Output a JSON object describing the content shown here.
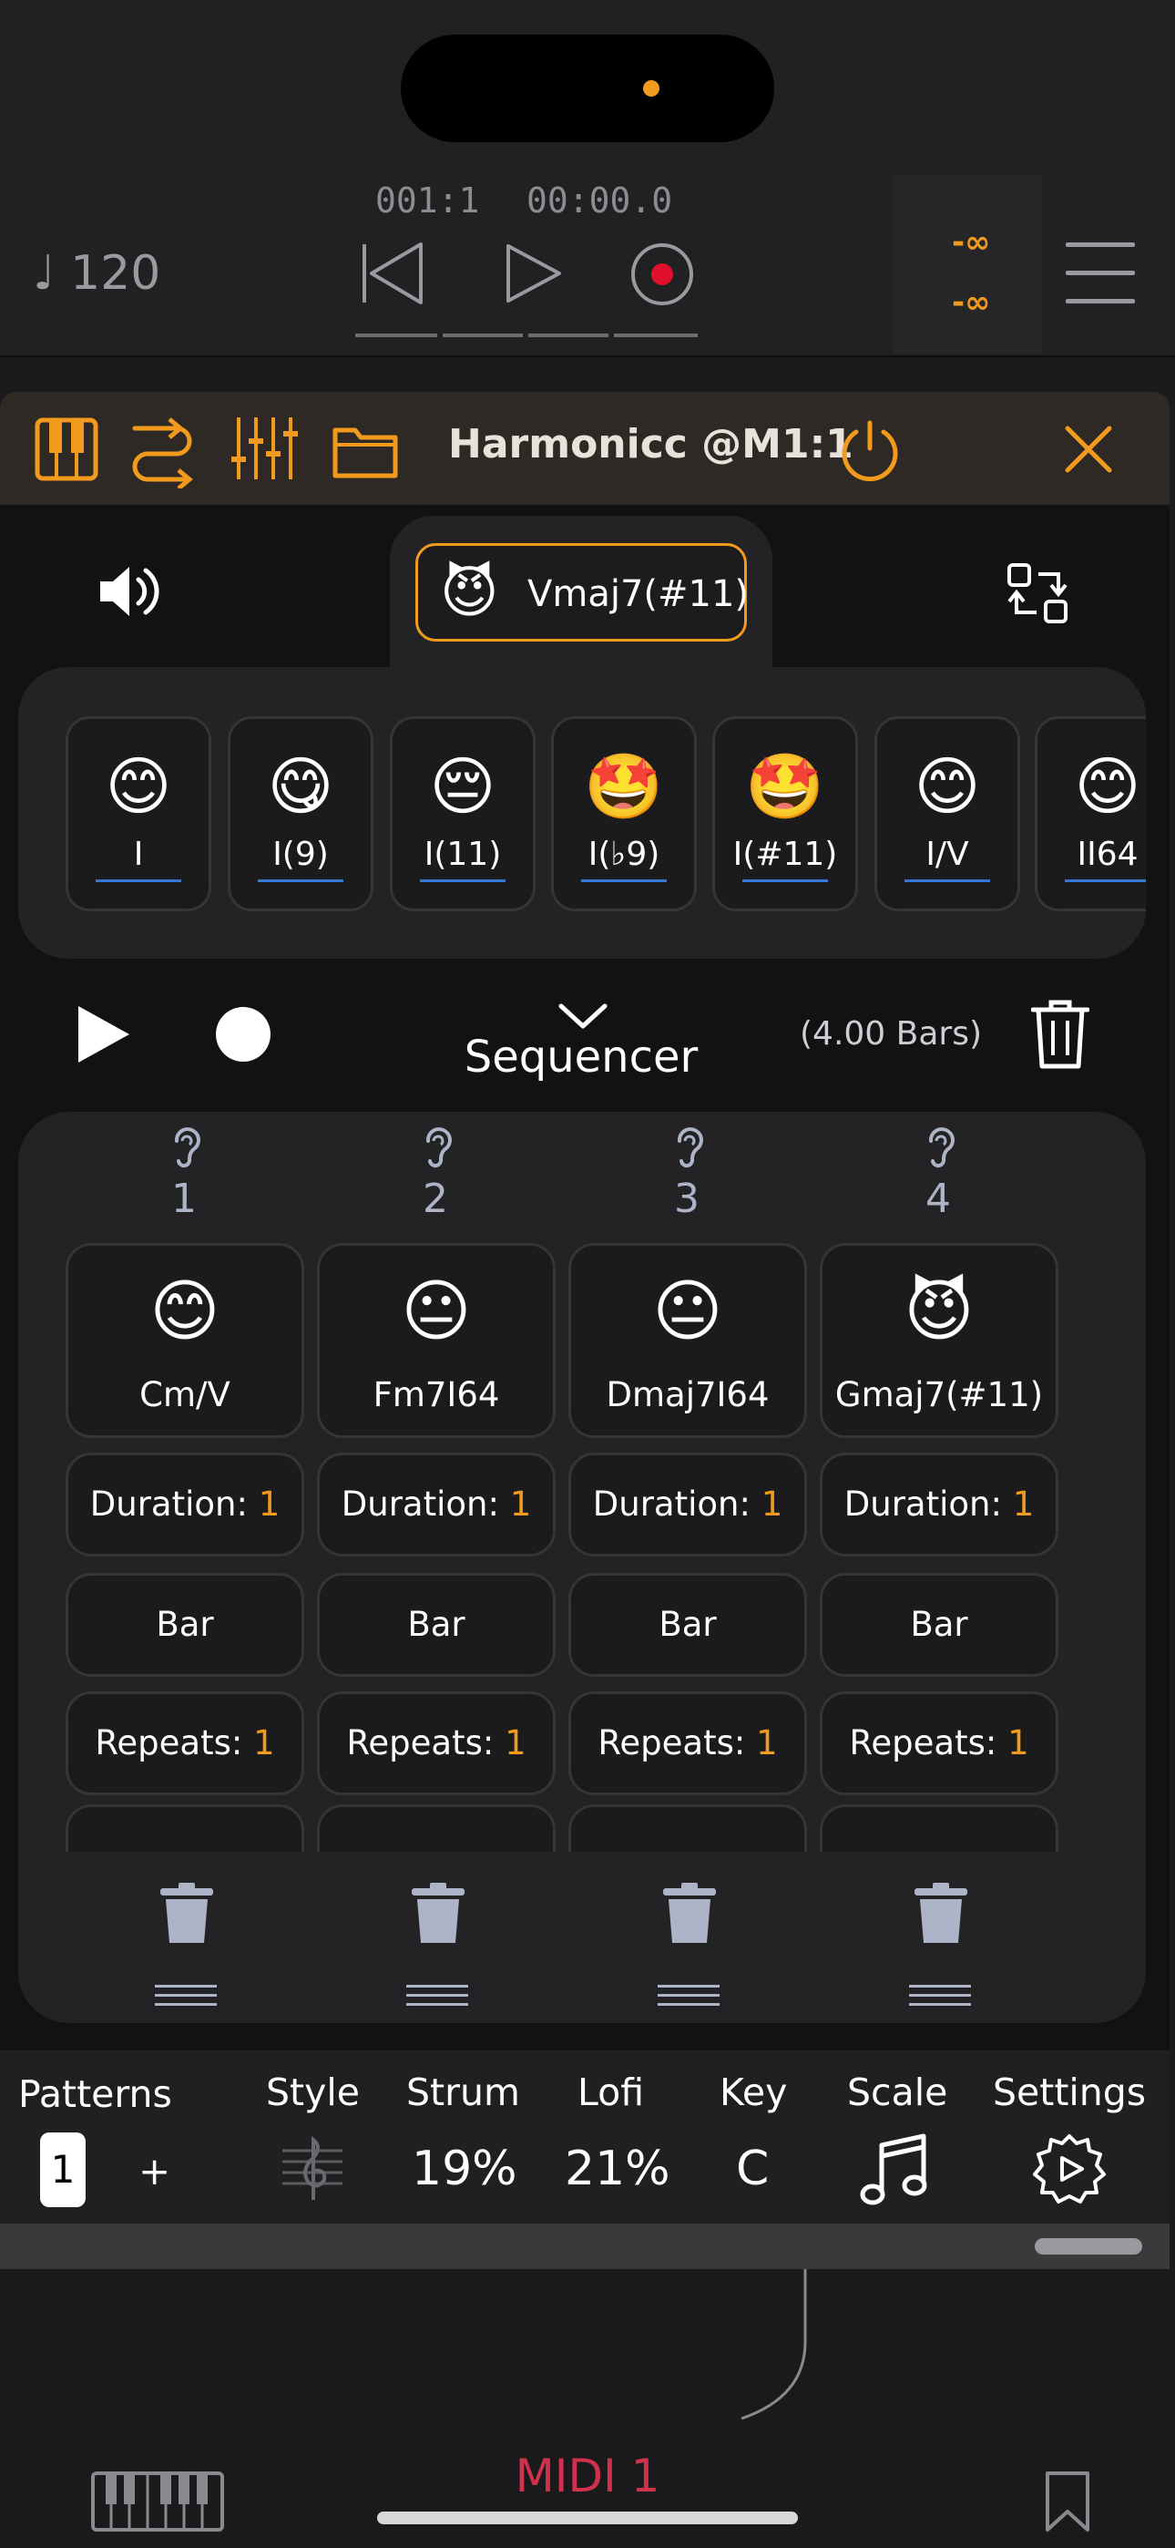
{
  "host": {
    "tempo": "120",
    "position_bars": "001:1",
    "position_time": "00:00.0",
    "meter_top": "-∞",
    "meter_bottom": "-∞",
    "track_label": "MIDI 1"
  },
  "plugin": {
    "title": "Harmonicc @M1:1",
    "current_chord": {
      "emoji": "😈",
      "label": "Vmaj7(#11)"
    },
    "palette": [
      {
        "emoji": "😊",
        "label": "I"
      },
      {
        "emoji": "😋",
        "label": "I(9)"
      },
      {
        "emoji": "😔",
        "label": "I(11)"
      },
      {
        "emoji": "🤩",
        "label": "I(♭9)"
      },
      {
        "emoji": "🤩",
        "label": "I(#11)"
      },
      {
        "emoji": "😊",
        "label": "I/V"
      },
      {
        "emoji": "😊",
        "label": "II64"
      }
    ]
  },
  "sequencer": {
    "label": "Sequencer",
    "length": "(4.00 Bars)",
    "steps": [
      {
        "number": "1",
        "emoji": "😊",
        "chord": "Cm/V",
        "duration_label": "Duration:",
        "duration": "1",
        "mode": "Bar",
        "repeats_label": "Repeats:",
        "repeats": "1"
      },
      {
        "number": "2",
        "emoji": "😐",
        "chord": "Fm7I64",
        "duration_label": "Duration:",
        "duration": "1",
        "mode": "Bar",
        "repeats_label": "Repeats:",
        "repeats": "1"
      },
      {
        "number": "3",
        "emoji": "😐",
        "chord": "Dmaj7I64",
        "duration_label": "Duration:",
        "duration": "1",
        "mode": "Bar",
        "repeats_label": "Repeats:",
        "repeats": "1"
      },
      {
        "number": "4",
        "emoji": "😈",
        "chord": "Gmaj7(#11)",
        "duration_label": "Duration:",
        "duration": "1",
        "mode": "Bar",
        "repeats_label": "Repeats:",
        "repeats": "1"
      }
    ]
  },
  "controls": {
    "patterns_label": "Patterns",
    "pattern_selected": "1",
    "pattern_add": "+",
    "style_label": "Style",
    "strum_label": "Strum",
    "strum_value": "19%",
    "lofi_label": "Lofi",
    "lofi_value": "21%",
    "key_label": "Key",
    "key_value": "C",
    "scale_label": "Scale",
    "settings_label": "Settings"
  },
  "colors": {
    "accent": "#f29a1e",
    "underline": "#3777d6",
    "track": "#d0314c"
  },
  "icons": {
    "header": [
      "piano-keys-icon",
      "route-icon",
      "mixer-sliders-icon",
      "folder-icon",
      "power-icon",
      "close-icon"
    ],
    "transport": [
      "skip-back-icon",
      "play-icon",
      "record-icon",
      "menu-icon"
    ],
    "plugin": [
      "speaker-icon",
      "swap-icon",
      "trash-icon",
      "ear-icon",
      "drag-handle-icon",
      "music-note-icon",
      "gear-icon",
      "treble-clef-icon",
      "bookmark-icon"
    ]
  }
}
